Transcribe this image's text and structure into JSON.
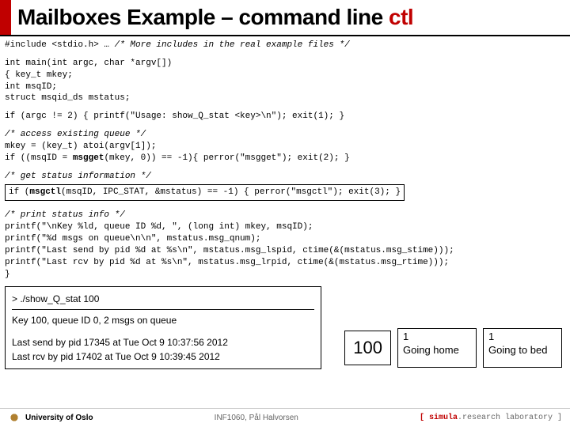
{
  "title": {
    "main": "Mailboxes Example – command line ",
    "accent": "ctl"
  },
  "code": {
    "l1a": "#include <stdio.h>  … ",
    "l1b": "/* More includes in the real example files */",
    "l2": "int main(int argc, char *argv[])",
    "l3": "{ key_t mkey;",
    "l4": "  int msqID;",
    "l5": "  struct msqid_ds mstatus;",
    "l6": "  if (argc != 2) { printf(\"Usage: show_Q_stat <key>\\n\"); exit(1); }",
    "l7": "  /* access existing queue */",
    "l8": "  mkey = (key_t) atoi(argv[1]);",
    "l9a": "  if ((msqID = ",
    "l9b": "msgget",
    "l9c": "(mkey, 0)) == -1){ perror(\"msgget\"); exit(2); }",
    "l10": "  /* get status information */",
    "l11a": "  if (",
    "l11b": "msgctl",
    "l11c": "(msqID, IPC_STAT, &mstatus) == -1) { perror(\"msgctl\"); exit(3); }",
    "l12": "  /* print status info */",
    "l13": "  printf(\"\\nKey %ld, queue ID %d, \", (long int) mkey, msqID);",
    "l14": "  printf(\"%d msgs on queue\\n\\n\", mstatus.msg_qnum);",
    "l15": "  printf(\"Last send by pid %d at %s\\n\", mstatus.msg_lspid, ctime(&(mstatus.msg_stime)));",
    "l16": "  printf(\"Last rcv by pid %d at %s\\n\", mstatus.msg_lrpid, ctime(&(mstatus.msg_rtime)));",
    "l17": "}"
  },
  "output": {
    "cmd": "> ./show_Q_stat  100",
    "l1": "Key 100, queue ID 0, 2 msgs on queue",
    "l2": "Last send by pid 17345 at Tue Oct 9 10:37:56 2012",
    "l3": "Last rcv by pid 17402 at Tue Oct 9 10:39:45 2012"
  },
  "queue": {
    "key": "100",
    "msg1_pri": "1",
    "msg1_txt": "Going home",
    "msg2_pri": "1",
    "msg2_txt": "Going to bed"
  },
  "footer": {
    "left": "University of Oslo",
    "center": "INF1060, Pål Halvorsen",
    "right_main": ".research laboratory ]",
    "right_accent": "[ simula"
  }
}
